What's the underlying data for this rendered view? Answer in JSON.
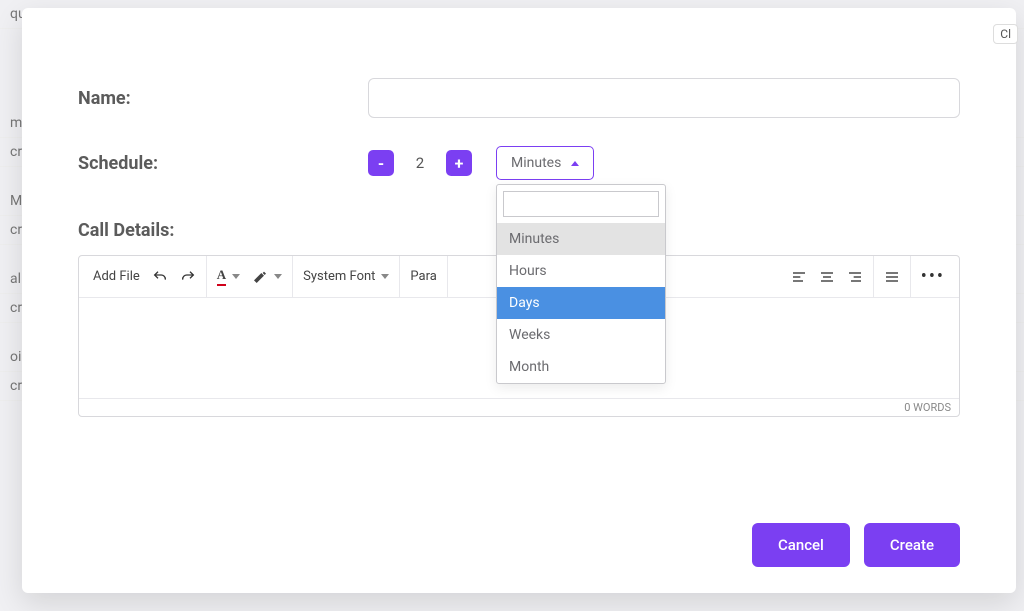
{
  "background": {
    "rows": [
      "quence",
      "",
      "ma",
      "cr",
      "MS",
      "cr",
      "all",
      "cr",
      "oi",
      "cr"
    ]
  },
  "modal": {
    "close_partial": "Cl",
    "fields": {
      "name_label": "Name:",
      "name_value": "",
      "schedule_label": "Schedule:",
      "schedule_value": "2",
      "minus": "-",
      "plus": "+",
      "unit_selected": "Minutes",
      "unit_options": [
        "Minutes",
        "Hours",
        "Days",
        "Weeks",
        "Month"
      ],
      "unit_highlighted": "Days",
      "call_details_label": "Call Details:"
    },
    "toolbar": {
      "add_file": "Add File",
      "font_family": "System Font",
      "block_format": "Para",
      "text_a": "A"
    },
    "editor": {
      "word_count": "0 WORDS"
    },
    "actions": {
      "cancel": "Cancel",
      "create": "Create"
    }
  }
}
